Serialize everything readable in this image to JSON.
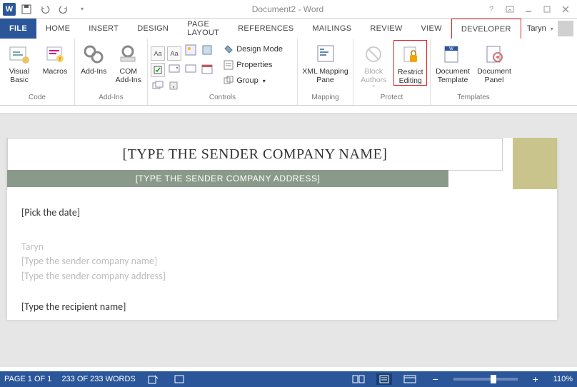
{
  "title": "Document2 - Word",
  "user": {
    "name": "Taryn"
  },
  "tabs": {
    "file": "FILE",
    "items": [
      "HOME",
      "INSERT",
      "DESIGN",
      "PAGE LAYOUT",
      "REFERENCES",
      "MAILINGS",
      "REVIEW",
      "VIEW",
      "DEVELOPER"
    ]
  },
  "ribbon": {
    "code": {
      "visual_basic": "Visual\nBasic",
      "macros": "Macros",
      "label": "Code"
    },
    "addins": {
      "addins": "Add-Ins",
      "com": "COM\nAdd-Ins",
      "label": "Add-Ins"
    },
    "controls": {
      "design_mode": "Design Mode",
      "properties": "Properties",
      "group": "Group",
      "label": "Controls"
    },
    "mapping": {
      "xml_pane": "XML Mapping\nPane",
      "label": "Mapping"
    },
    "protect": {
      "block_authors": "Block\nAuthors",
      "restrict_editing": "Restrict\nEditing",
      "label": "Protect"
    },
    "templates": {
      "doc_template": "Document\nTemplate",
      "doc_panel": "Document\nPanel",
      "label": "Templates"
    }
  },
  "document": {
    "company_name": "[TYPE THE SENDER COMPANY NAME]",
    "company_address": "[TYPE THE SENDER COMPANY ADDRESS]",
    "pick_date": "[Pick the date]",
    "sender_name": "Taryn",
    "sender_company": "[Type the sender company name]",
    "sender_address": "[Type the sender company address]",
    "recipient_name": "[Type the recipient name]"
  },
  "status": {
    "page": "PAGE 1 OF 1",
    "words": "233 OF 233 WORDS",
    "zoom": "110%"
  }
}
